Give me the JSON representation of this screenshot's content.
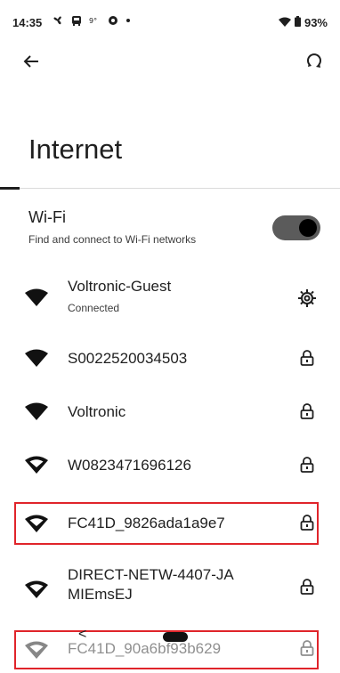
{
  "status_bar": {
    "time": "14:35",
    "notif_icons": [
      "fan-icon",
      "bus-icon",
      "weather-icon",
      "circle-app-icon",
      "dot-icon"
    ],
    "battery_text": "93%"
  },
  "page": {
    "title": "Internet",
    "back_icon": "arrow-left-icon",
    "reload_icon": "network-reset-icon"
  },
  "wifi": {
    "title": "Wi-Fi",
    "subtitle": "Find and connect to Wi-Fi networks",
    "enabled": true
  },
  "networks": [
    {
      "name": "Voltronic-Guest",
      "status": "Connected",
      "action_icon": "gear-icon",
      "signal": "full"
    },
    {
      "name": "S0022520034503",
      "status": "",
      "action_icon": "lock-icon",
      "signal": "full"
    },
    {
      "name": "Voltronic",
      "status": "",
      "action_icon": "lock-icon",
      "signal": "full"
    },
    {
      "name": "W0823471696126",
      "status": "",
      "action_icon": "lock-icon",
      "signal": "partial"
    },
    {
      "name": "FC41D_9826ada1a9e7",
      "status": "",
      "action_icon": "lock-icon",
      "signal": "partial",
      "highlighted": true
    },
    {
      "name": "DIRECT-NETW-4407-JA MIEmsEJ",
      "name_line1": "DIRECT-NETW-4407-JA",
      "name_line2": "MIEmsEJ",
      "status": "",
      "action_icon": "lock-icon",
      "signal": "partial"
    },
    {
      "name": "FC41D_90a6bf93b629",
      "status": "",
      "action_icon": "lock-icon",
      "signal": "partial",
      "highlighted": true,
      "faded": true
    }
  ],
  "colors": {
    "highlight_border": "#e0242a",
    "toggle_track": "#5b5b5b",
    "text": "#1f1f1f"
  },
  "nav": {
    "back_glyph": "<",
    "handle": "gesture-handle"
  }
}
